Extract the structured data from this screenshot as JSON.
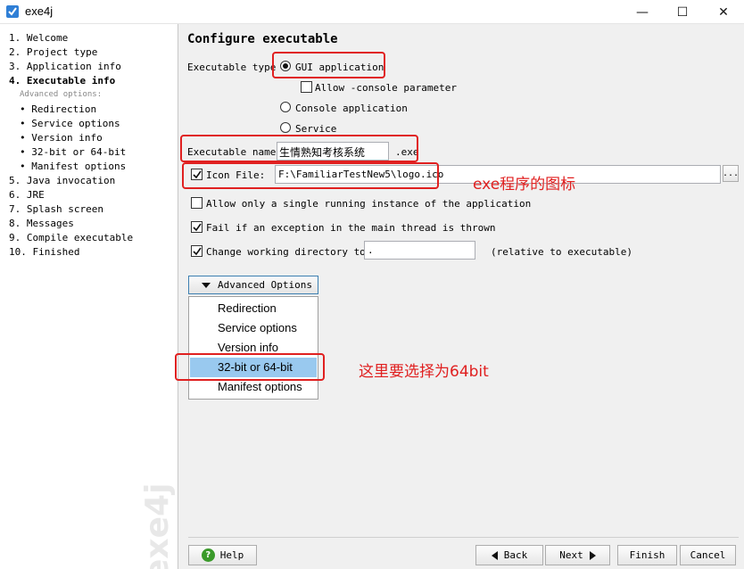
{
  "window": {
    "title": "exe4j",
    "minimize_glyph": "—",
    "maximize_glyph": "☐",
    "close_glyph": "✕"
  },
  "sidebar": {
    "steps": [
      "1. Welcome",
      "2. Project type",
      "3. Application info",
      "4. Executable info",
      "Advanced options:",
      "• Redirection",
      "• Service options",
      "• Version info",
      "• 32-bit or 64-bit",
      "• Manifest options",
      "5. Java invocation",
      "6. JRE",
      "7. Splash screen",
      "8. Messages",
      "9. Compile executable",
      "10. Finished"
    ],
    "watermark": "exe4j"
  },
  "main": {
    "title": "Configure executable",
    "executable_type_label": "Executable type",
    "gui_application": "GUI application",
    "allow_console": "Allow -console parameter",
    "console_application": "Console application",
    "service": "Service",
    "executable_name_label": "Executable name:",
    "executable_name_value": "生情熟知考核系统",
    "exe_suffix": ".exe",
    "icon_file_label": "Icon File:",
    "icon_file_value": "F:\\FamiliarTestNew5\\logo.ico",
    "browse_label": "...",
    "allow_single_instance": "Allow only a single running instance of the application",
    "fail_on_exception": "Fail if an exception in the main thread is thrown",
    "change_working_dir": "Change working directory to:",
    "working_dir_value": ".",
    "relative_note": "(relative to executable)",
    "advanced_options_button": "Advanced Options",
    "advanced_menu": [
      "Redirection",
      "Service options",
      "Version info",
      "32-bit or 64-bit",
      "Manifest options"
    ]
  },
  "annotations": {
    "icon_note": "exe程序的图标",
    "bit_note": "这里要选择为64bit",
    "color": "#e02020"
  },
  "footer": {
    "help": "Help",
    "back": "Back",
    "next": "Next",
    "finish": "Finish",
    "cancel": "Cancel"
  }
}
